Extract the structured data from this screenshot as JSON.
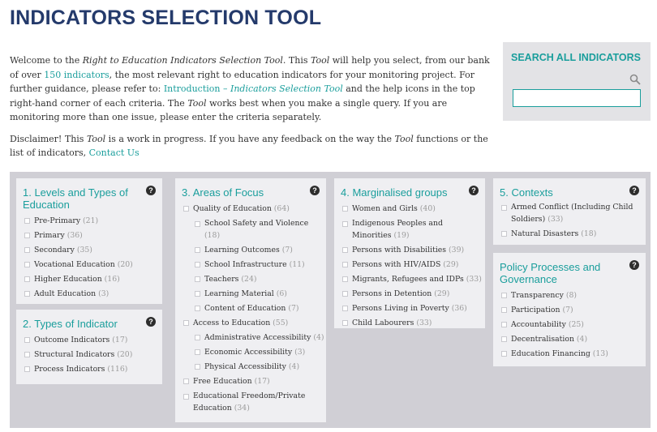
{
  "page": {
    "title": "INDICATORS SELECTION TOOL"
  },
  "intro": {
    "p1_a": "Welcome to the ",
    "p1_b": "Right to Education Indicators Selection Tool",
    "p1_c": ". This ",
    "p1_d": "Tool",
    "p1_e": " will help you select, from our bank of over ",
    "p1_link1": "150 indicators",
    "p1_f": ", the most relevant right to education indicators for your monitoring project. For further guidance, please refer to: ",
    "p1_link2a": "Introduction – ",
    "p1_link2b": "Indicators Selection Tool",
    "p1_g": " and the help icons in the top right-hand corner of each criteria. The ",
    "p1_h": "Tool",
    "p1_i": " works best when you make a single query. If you are monitoring more than one issue, please enter the criteria separately.",
    "p2_a": "Disclaimer! This ",
    "p2_b": "Tool",
    "p2_c": " is a work in progress. If you have any feedback on the way the ",
    "p2_d": "Tool",
    "p2_e": " functions or the list of indicators, ",
    "p2_link": "Contact Us"
  },
  "search": {
    "title": "SEARCH ALL INDICATORS",
    "value": "",
    "placeholder": ""
  },
  "help_label": "?",
  "cards": {
    "levels": {
      "title": "1. Levels and Types of Education",
      "items": [
        {
          "label": "Pre-Primary",
          "count": "(21)"
        },
        {
          "label": "Primary",
          "count": "(36)"
        },
        {
          "label": "Secondary",
          "count": "(35)"
        },
        {
          "label": "Vocational Education",
          "count": "(20)"
        },
        {
          "label": "Higher Education",
          "count": "(16)"
        },
        {
          "label": "Adult Education",
          "count": "(3)"
        }
      ]
    },
    "types": {
      "title": "2. Types of Indicator",
      "items": [
        {
          "label": "Outcome Indicators",
          "count": "(17)"
        },
        {
          "label": "Structural Indicators",
          "count": "(20)"
        },
        {
          "label": "Process Indicators",
          "count": "(116)"
        }
      ]
    },
    "focus": {
      "title": "3. Areas of Focus",
      "items": [
        {
          "label": "Quality of Education",
          "count": "(64)"
        },
        {
          "label": "School Safety and Violence",
          "count": "(18)"
        },
        {
          "label": "Learning Outcomes",
          "count": "(7)"
        },
        {
          "label": "School Infrastructure",
          "count": "(11)"
        },
        {
          "label": "Teachers",
          "count": "(24)"
        },
        {
          "label": "Learning Material",
          "count": "(6)"
        },
        {
          "label": "Content of Education",
          "count": "(7)"
        },
        {
          "label": "Access to Education",
          "count": "(55)"
        },
        {
          "label": "Administrative Accessibility",
          "count": "(4)"
        },
        {
          "label": "Economic Accessibility",
          "count": "(3)"
        },
        {
          "label": "Physical Accessibility",
          "count": "(4)"
        },
        {
          "label": "Free Education",
          "count": "(17)"
        },
        {
          "label": "Educational Freedom/Private Education",
          "count": "(34)"
        }
      ]
    },
    "marginalised": {
      "title": "4. Marginalised groups",
      "items": [
        {
          "label": "Women and Girls",
          "count": "(40)"
        },
        {
          "label": "Indigenous Peoples and Minorities",
          "count": "(19)"
        },
        {
          "label": "Persons with Disabilities",
          "count": "(39)"
        },
        {
          "label": "Persons with HIV/AIDS",
          "count": "(29)"
        },
        {
          "label": "Migrants, Refugees and IDPs",
          "count": "(33)"
        },
        {
          "label": "Persons in Detention",
          "count": "(29)"
        },
        {
          "label": "Persons Living in Poverty",
          "count": "(36)"
        },
        {
          "label": "Child Labourers",
          "count": "(33)"
        }
      ]
    },
    "contexts": {
      "title": "5. Contexts",
      "items": [
        {
          "label": "Armed Conflict (Including Child Soldiers)",
          "count": "(33)"
        },
        {
          "label": "Natural Disasters",
          "count": "(18)"
        }
      ]
    },
    "policy": {
      "title": "Policy Processes and Governance",
      "items": [
        {
          "label": "Transparency",
          "count": "(8)"
        },
        {
          "label": "Participation",
          "count": "(7)"
        },
        {
          "label": "Accountability",
          "count": "(25)"
        },
        {
          "label": "Decentralisation",
          "count": "(4)"
        },
        {
          "label": "Education Financing",
          "count": "(13)"
        }
      ]
    }
  }
}
